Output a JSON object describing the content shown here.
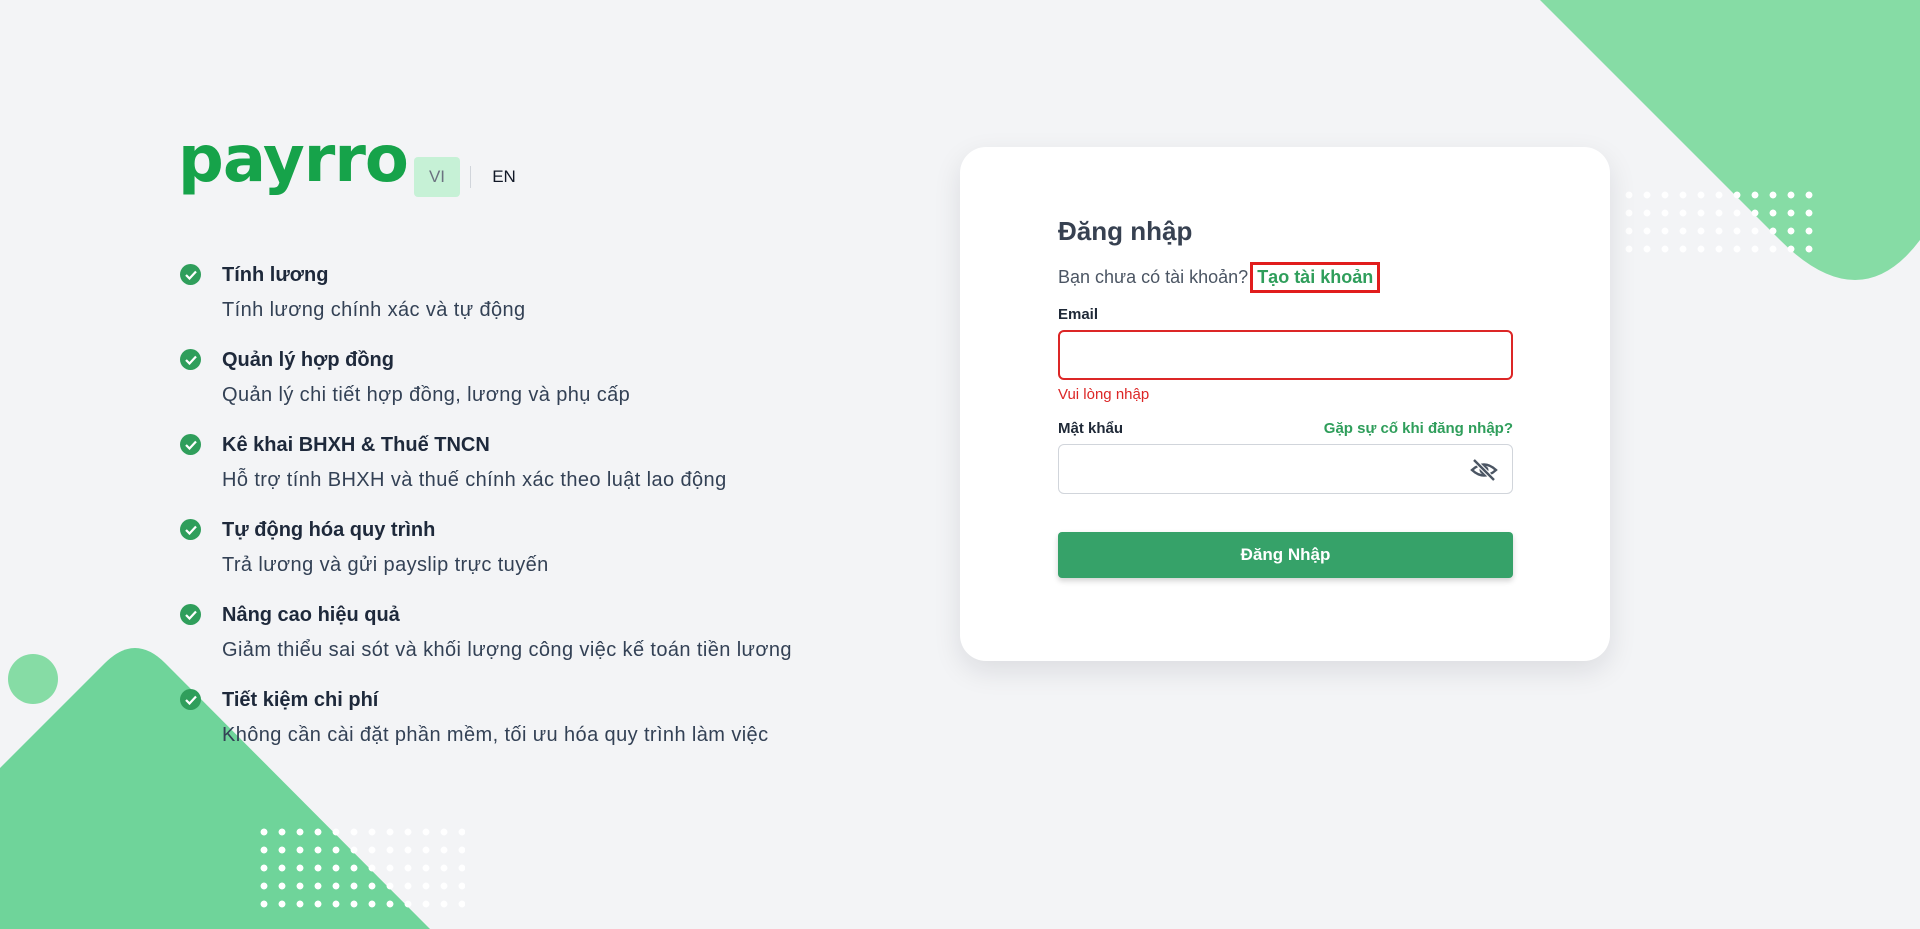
{
  "brand": {
    "logo_text": "payrro",
    "accent": "#2f9e5b",
    "error": "#dc2626"
  },
  "language": {
    "options": [
      "VI",
      "EN"
    ],
    "selected": "VI"
  },
  "features": [
    {
      "title": "Tính lương",
      "desc": "Tính lương chính xác và tự động",
      "icon": "check-circle-icon"
    },
    {
      "title": "Quản lý hợp đồng",
      "desc": "Quản lý chi tiết hợp đồng, lương và phụ cấp",
      "icon": "check-circle-icon"
    },
    {
      "title": "Kê khai BHXH & Thuế TNCN",
      "desc": "Hỗ trợ tính BHXH và thuế chính xác theo luật lao động",
      "icon": "check-circle-icon"
    },
    {
      "title": "Tự động hóa quy trình",
      "desc": "Trả lương và gửi payslip trực tuyến",
      "icon": "check-circle-icon"
    },
    {
      "title": "Nâng cao hiệu quả",
      "desc": "Giảm thiểu sai sót và khối lượng công việc kế toán tiền lương",
      "icon": "check-circle-icon"
    },
    {
      "title": "Tiết kiệm chi phí",
      "desc": "Không cần cài đặt phần mềm, tối ưu hóa quy trình làm việc",
      "icon": "check-circle-icon"
    }
  ],
  "login": {
    "title": "Đăng nhập",
    "no_account_text": "Bạn chưa có tài khoản?",
    "create_account_link": "Tạo tài khoản",
    "email_label": "Email",
    "email_value": "",
    "email_error": "Vui lòng nhập",
    "password_label": "Mật khẩu",
    "password_value": "",
    "forgot_link": "Gặp sự cố khi đăng nhập?",
    "password_toggle_icon": "eye-off-icon",
    "submit_label": "Đăng Nhập"
  }
}
